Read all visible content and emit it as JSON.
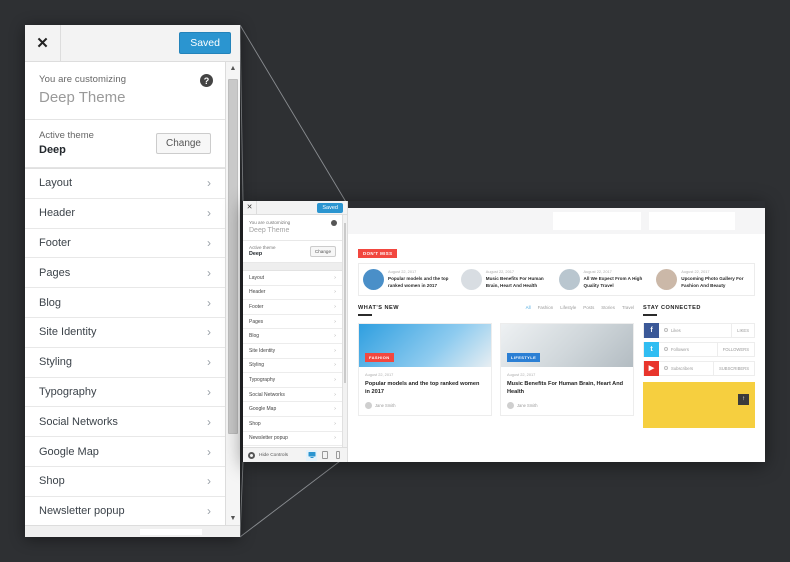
{
  "background_color": "#2e3033",
  "customizer": {
    "close_icon": "close-icon",
    "close_glyph": "✕",
    "save_label": "Saved",
    "save_color": "#2b95d0",
    "help_glyph": "?",
    "customizing_label": "You are customizing",
    "site_title": "Deep Theme",
    "active_theme_label": "Active theme",
    "active_theme_name": "Deep",
    "change_label": "Change",
    "menu_items": [
      {
        "label": "Layout"
      },
      {
        "label": "Header"
      },
      {
        "label": "Footer"
      },
      {
        "label": "Pages"
      },
      {
        "label": "Blog"
      },
      {
        "label": "Site Identity"
      },
      {
        "label": "Styling"
      },
      {
        "label": "Typography"
      },
      {
        "label": "Social Networks"
      },
      {
        "label": "Google Map"
      },
      {
        "label": "Shop"
      },
      {
        "label": "Newsletter popup"
      }
    ],
    "chevron_glyph": "›",
    "scroll_up_glyph": "▲",
    "scroll_down_glyph": "▼",
    "hide_controls_label": "Hide Controls",
    "devices": [
      {
        "name": "desktop-preview",
        "active": true
      },
      {
        "name": "tablet-preview",
        "active": false
      },
      {
        "name": "mobile-preview",
        "active": false
      }
    ]
  },
  "preview": {
    "dont_miss_badge": "DON'T MISS",
    "dont_miss_posts": [
      {
        "date": "August 22, 2017",
        "title": "Popular models and the top ranked women in 2017",
        "thumb_color": "#4a8fc8"
      },
      {
        "date": "August 22, 2017",
        "title": "Music Benefits For Human Brain, Heart And Health",
        "thumb_color": "#d8dde2"
      },
      {
        "date": "August 22, 2017",
        "title": "All We Expect From A High Quality Travel",
        "thumb_color": "#b9c6cf"
      },
      {
        "date": "August 22, 2017",
        "title": "Upcoming Photo Gallery For Fashion And Beauty",
        "thumb_color": "#cbb8a8"
      }
    ],
    "whats_new_title": "WHAT'S NEW",
    "filter_tabs": [
      {
        "label": "All",
        "active": true
      },
      {
        "label": "Fashion",
        "active": false
      },
      {
        "label": "Lifestyle",
        "active": false
      },
      {
        "label": "Posts",
        "active": false
      },
      {
        "label": "Stories",
        "active": false
      },
      {
        "label": "Travel",
        "active": false
      }
    ],
    "articles": [
      {
        "badge": "FASHION",
        "badge_color": "#f2473f",
        "date": "August 22, 2017",
        "title": "Popular models and the top ranked women in 2017",
        "author": "Jane Smith",
        "image_color": "#2f9fe0"
      },
      {
        "badge": "LIFESTYLE",
        "badge_color": "#2b7fd4",
        "date": "August 22, 2017",
        "title": "Music Benefits For Human Brain, Heart And Health",
        "author": "Jane Smith",
        "image_color": "#dfe3e6"
      }
    ],
    "sidebar_title": "STAY CONNECTED",
    "social": [
      {
        "network": "facebook",
        "glyph": "f",
        "color": "#3b5998",
        "label": "Likes",
        "count_label": "LIKES"
      },
      {
        "network": "twitter",
        "glyph": "t",
        "color": "#30bdf2",
        "label": "Followers",
        "count_label": "FOLLOWERS"
      },
      {
        "network": "youtube",
        "glyph": "▶",
        "color": "#e8352c",
        "label": "Subscribers",
        "count_label": "SUBSCRIBERS"
      }
    ],
    "ad_color": "#f6cf3f",
    "back_to_top_glyph": "↑"
  }
}
